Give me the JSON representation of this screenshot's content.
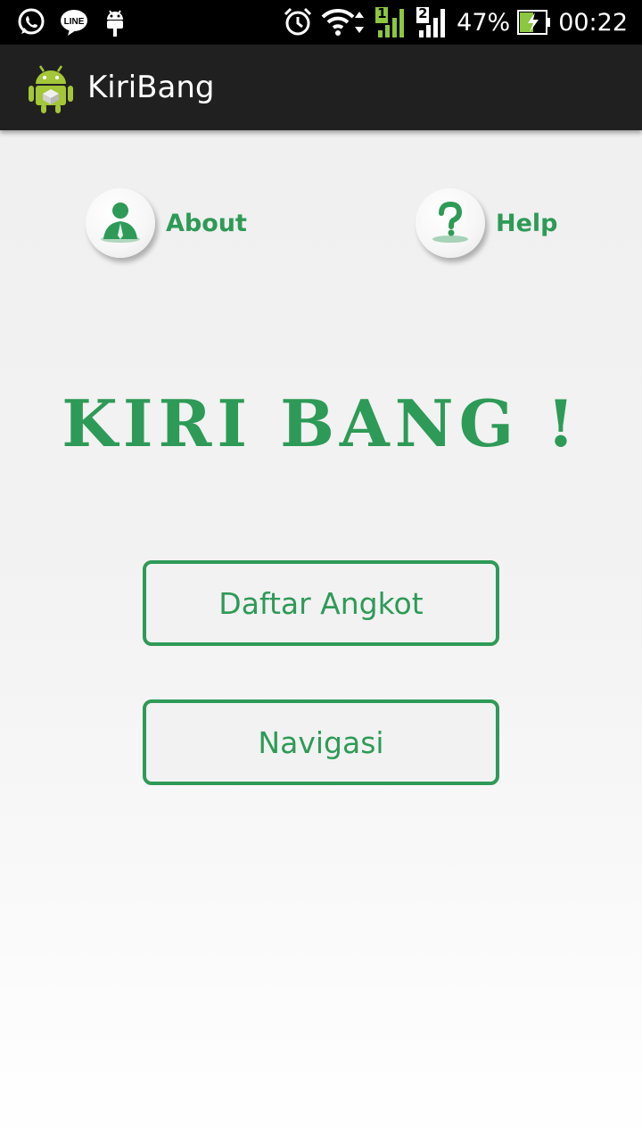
{
  "status_bar": {
    "battery_percent": "47%",
    "time": "00:22",
    "sim1_label": "1",
    "sim2_label": "2",
    "notification_icons": [
      "whatsapp-icon",
      "line-icon",
      "android-debug-icon"
    ],
    "system_icons": [
      "alarm-icon",
      "wifi-icon",
      "signal-sim1-icon",
      "signal-sim2-icon",
      "battery-charging-icon"
    ]
  },
  "action_bar": {
    "title": "KiriBang",
    "icon": "android-app-icon"
  },
  "main": {
    "about_label": "About",
    "help_label": "Help",
    "headline": "KIRI BANG !",
    "daftar_angkot_label": "Daftar Angkot",
    "navigasi_label": "Navigasi"
  },
  "colors": {
    "accent": "#2e9a57",
    "action_bar": "#202020",
    "status_bar": "#000000"
  }
}
